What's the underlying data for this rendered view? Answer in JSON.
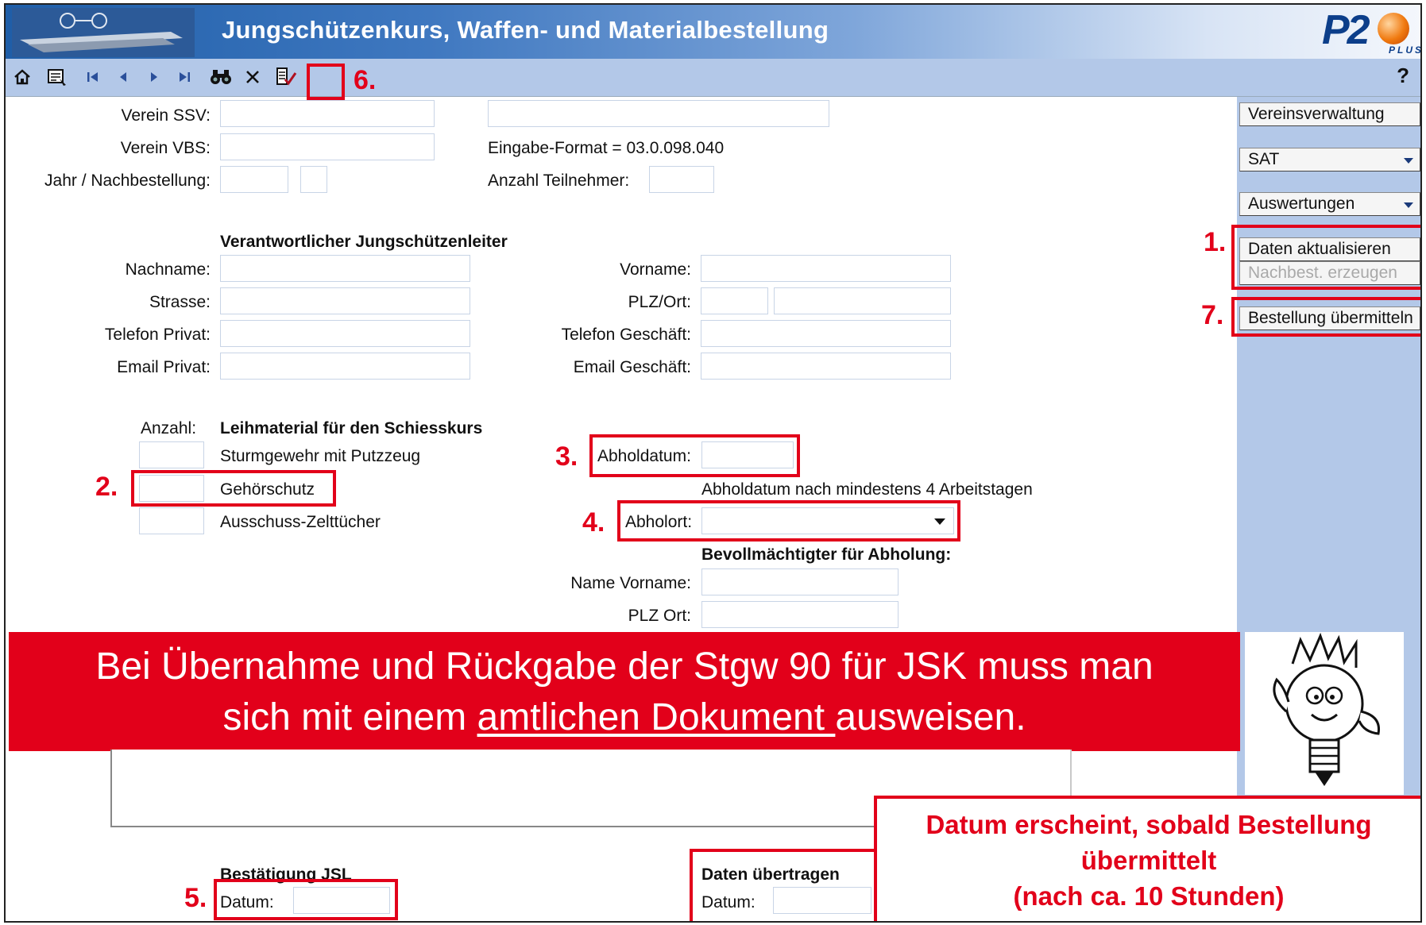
{
  "title": "Jungschützenkurs, Waffen- und Materialbestellung",
  "logo": "P2 PLUS",
  "help": "?",
  "toolbar_icons": [
    "home-icon",
    "form-edit-icon",
    "first-record-icon",
    "previous-record-icon",
    "next-record-icon",
    "last-record-icon",
    "binoculars-icon",
    "delete-icon",
    "save-check-icon"
  ],
  "form": {
    "verein_ssv_label": "Verein SSV:",
    "verein_vbs_label": "Verein VBS:",
    "jahr_label": "Jahr / Nachbestellung:",
    "eingabe_format": "Eingabe-Format = 03.0.098.040",
    "anzahl_teilnehmer_label": "Anzahl Teilnehmer:",
    "leiter_heading": "Verantwortlicher Jungschützenleiter",
    "nachname_label": "Nachname:",
    "vorname_label": "Vorname:",
    "strasse_label": "Strasse:",
    "plz_ort_label": "PLZ/Ort:",
    "tel_privat_label": "Telefon Privat:",
    "tel_geschaeft_label": "Telefon Geschäft:",
    "email_privat_label": "Email Privat:",
    "email_geschaeft_label": "Email Geschäft:",
    "anzahl_label": "Anzahl:",
    "leihmaterial_heading": "Leihmaterial für den Schiesskurs",
    "item_sturmgewehr": "Sturmgewehr mit Putzzeug",
    "item_gehoerschutz": "Gehörschutz",
    "item_zelttuecher": "Ausschuss-Zelttücher",
    "abholdatum_label": "Abholdatum:",
    "abholdatum_note": "Abholdatum nach mindestens 4 Arbeitstagen",
    "abholort_label": "Abholort:",
    "bevollmaechtigter_heading": "Bevollmächtigter für Abholung:",
    "name_vorname_label": "Name Vorname:",
    "plz_ort2_label": "PLZ Ort:",
    "bestaetigung_heading": "Bestätigung JSL",
    "datum_label": "Datum:",
    "daten_uebertragen_heading": "Daten übertragen",
    "datum2_label": "Datum:"
  },
  "sidebar": {
    "vereinsverwaltung": "Vereinsverwaltung",
    "sat": "SAT",
    "auswertungen": "Auswertungen",
    "daten_aktualisieren": "Daten aktualisieren",
    "nachbest_erzeugen": "Nachbest. erzeugen",
    "bestellung_uebermitteln": "Bestellung übermitteln"
  },
  "steps": {
    "s1": "1.",
    "s2": "2.",
    "s3": "3.",
    "s4": "4.",
    "s5": "5.",
    "s6": "6.",
    "s7": "7."
  },
  "banner": {
    "line1": "Bei Übernahme und Rückgabe der Stgw 90 für JSK muss man",
    "line2_prefix": "sich mit einem ",
    "line2_underlined": "amtlichen Dokument ",
    "line2_suffix": "ausweisen."
  },
  "note": {
    "line1": "Datum erscheint, sobald Bestellung",
    "line2": "übermittelt",
    "line3": "(nach ca. 10 Stunden)"
  },
  "colors": {
    "accent_red": "#e2001a",
    "panel_blue": "#b3c8e8",
    "title_blue": "#1f5ea8"
  }
}
